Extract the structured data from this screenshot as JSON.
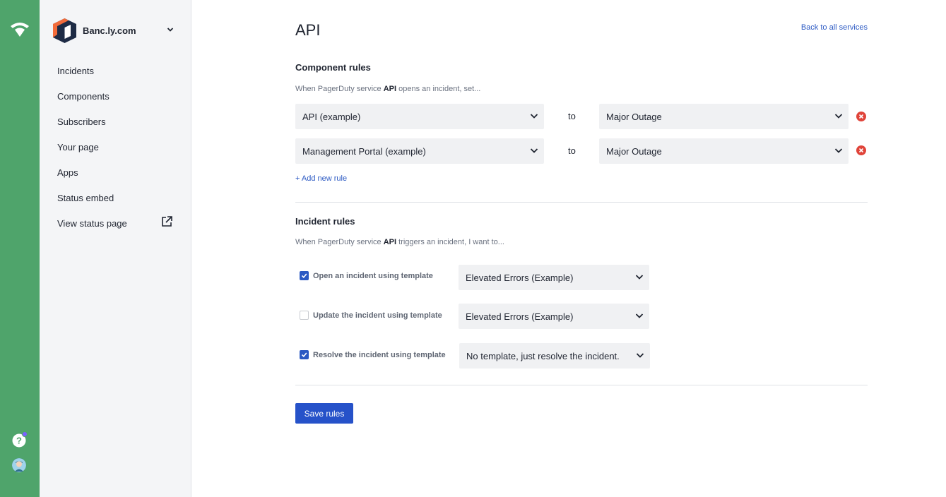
{
  "rail": {
    "logo_icon": "wifi-status-icon",
    "help_icon": "help-circle-icon",
    "avatar_icon": "user-avatar-icon",
    "accent": "#4fa46b",
    "notification_color": "#7b61ff"
  },
  "sidebar": {
    "org_name": "Banc.ly.com",
    "items": [
      {
        "label": "Incidents"
      },
      {
        "label": "Components"
      },
      {
        "label": "Subscribers"
      },
      {
        "label": "Your page"
      },
      {
        "label": "Apps"
      },
      {
        "label": "Status embed"
      },
      {
        "label": "View status page",
        "icon": "external-link-icon"
      }
    ]
  },
  "main": {
    "title": "API",
    "back_link": "Back to all services",
    "component_rules": {
      "title": "Component rules",
      "desc_prefix": "When PagerDuty service",
      "desc_service": "API",
      "desc_suffix": "opens an incident, set...",
      "rules": [
        {
          "component": "API (example)",
          "to_label": "to",
          "status": "Major Outage"
        },
        {
          "component": "Management Portal (example)",
          "to_label": "to",
          "status": "Major Outage"
        }
      ],
      "add_rule": "+ Add new rule"
    },
    "incident_rules": {
      "title": "Incident rules",
      "desc_prefix": "When PagerDuty service",
      "desc_service": "API",
      "desc_suffix": "triggers an incident, I want to...",
      "rules": [
        {
          "checked": true,
          "label": "Open an incident using template",
          "template": "Elevated Errors (Example)"
        },
        {
          "checked": false,
          "label": "Update the incident using template",
          "template": "Elevated Errors (Example)"
        },
        {
          "checked": true,
          "label": "Resolve the incident using template",
          "template": "No template, just resolve the incident."
        }
      ]
    },
    "save_label": "Save rules",
    "colors": {
      "link": "#2b59c3",
      "button": "#2652c9",
      "remove": "#e0443a"
    }
  }
}
